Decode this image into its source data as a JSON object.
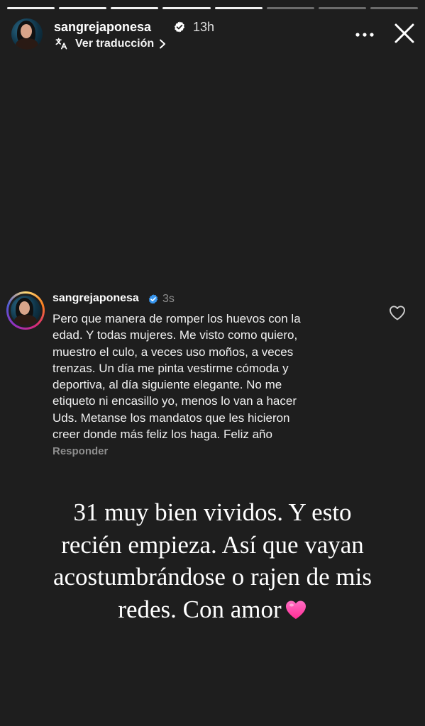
{
  "story": {
    "progress_segments": 8,
    "progress_done": 5,
    "username": "sangrejaponesa",
    "verified_icon": "verified-badge-icon",
    "time": "13h",
    "translate_label": "Ver traducción",
    "more_icon": "more-horizontal-icon",
    "close_icon": "close-icon"
  },
  "comment": {
    "username": "sangrejaponesa",
    "time": "3s",
    "text": "Pero que manera de romper los huevos con la\nedad. Y todas mujeres. Me visto como quiero,\nmuestro el culo, a veces uso moños, a veces\ntrenzas. Un día me pinta vestirme cómoda y\ndeportiva, al día siguiente elegante. No me\netiqueto ni encasillo yo, menos lo van a hacer\nUds. Metanse los mandatos que les hicieron\ncreer donde más feliz los haga. Feliz año",
    "reply_label": "Responder",
    "like_icon": "heart-outline-icon"
  },
  "caption": {
    "text": "31 muy bien vividos. Y esto\nrecién empieza. Así que vayan\nacostumbrándose o rajen de mis\nredes. Con amor",
    "emoji_icon": "pink-heart-icon"
  },
  "colors": {
    "background": "#1e1e1e",
    "verified": "#3897f0",
    "heart_emoji": "#ff3fa4",
    "secondary_text": "#8e8e8e"
  }
}
